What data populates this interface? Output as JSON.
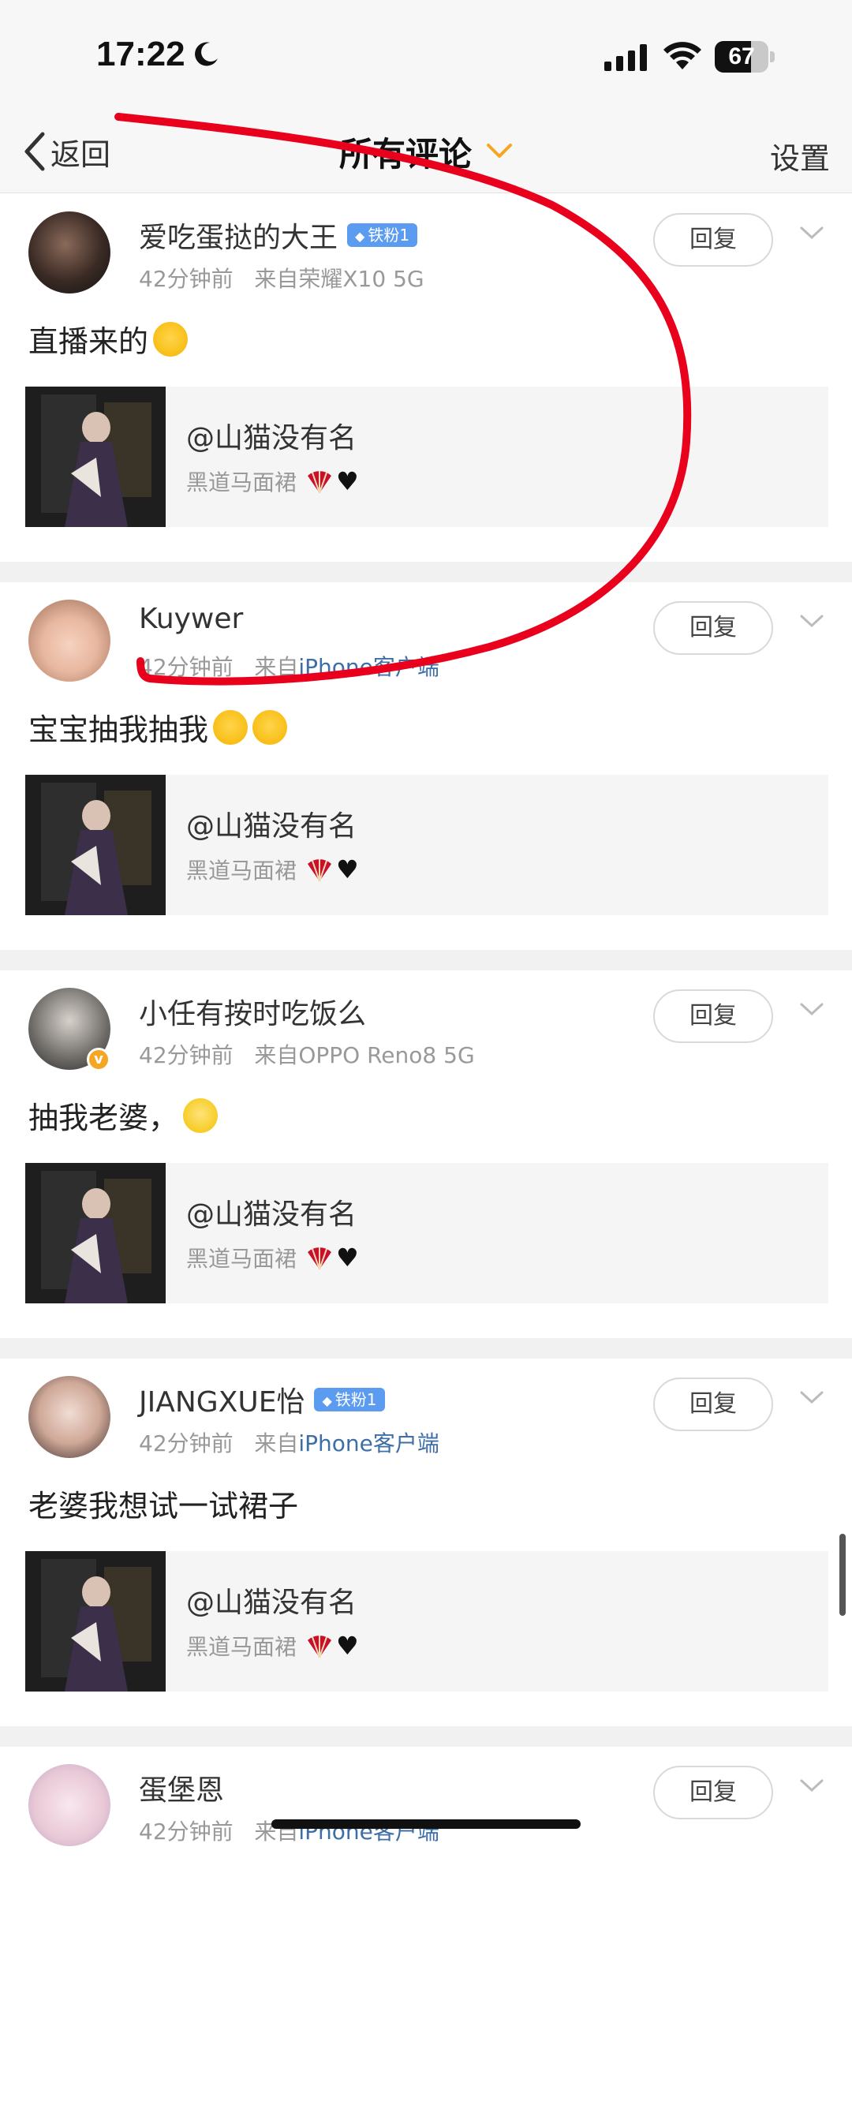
{
  "status": {
    "time": "17:22",
    "battery": "67",
    "battery_level": 0.67
  },
  "nav": {
    "back": "返回",
    "title": "所有评论",
    "settings": "设置"
  },
  "reply_label": "回复",
  "comments": [
    {
      "user": "爱吃蛋挞的大王",
      "badge": "铁粉1",
      "time": "42分钟前",
      "source_prefix": "来自",
      "source": "荣耀X10 5G",
      "source_link": false,
      "text": "直播来的",
      "emojis": [
        "heart-eyes"
      ],
      "card": {
        "title": "@山猫没有名",
        "subtitle": "黑道马面裙"
      }
    },
    {
      "user": "Kuywer",
      "badge": "",
      "time": "42分钟前",
      "source_prefix": "来自",
      "source": "iPhone客户端",
      "source_link": true,
      "text": "宝宝抽我抽我",
      "emojis": [
        "loudly-crying",
        "loudly-crying"
      ],
      "card": {
        "title": "@山猫没有名",
        "subtitle": "黑道马面裙"
      }
    },
    {
      "user": "小任有按时吃饭么",
      "badge": "",
      "time": "42分钟前",
      "source_prefix": "来自",
      "source": "OPPO Reno8 5G",
      "source_link": false,
      "text": "抽我老婆，",
      "emojis": [
        "crying"
      ],
      "card": {
        "title": "@山猫没有名",
        "subtitle": "黑道马面裙"
      }
    },
    {
      "user": "JIANGXUE怡",
      "badge": "铁粉1",
      "time": "42分钟前",
      "source_prefix": "来自",
      "source": "iPhone客户端",
      "source_link": true,
      "text": "老婆我想试一试裙子",
      "emojis": [],
      "card": {
        "title": "@山猫没有名",
        "subtitle": "黑道马面裙"
      }
    },
    {
      "user": "蛋堡恩",
      "badge": "",
      "time": "42分钟前",
      "source_prefix": "来自",
      "source": "iPhone客户端",
      "source_link": true,
      "text": "",
      "emojis": [],
      "card": null
    }
  ],
  "colors": {
    "accent_orange": "#f5a623",
    "link_blue": "#3d6fa6",
    "annotation_red": "#e8001c",
    "fan_badge": "#5b9cf0"
  }
}
